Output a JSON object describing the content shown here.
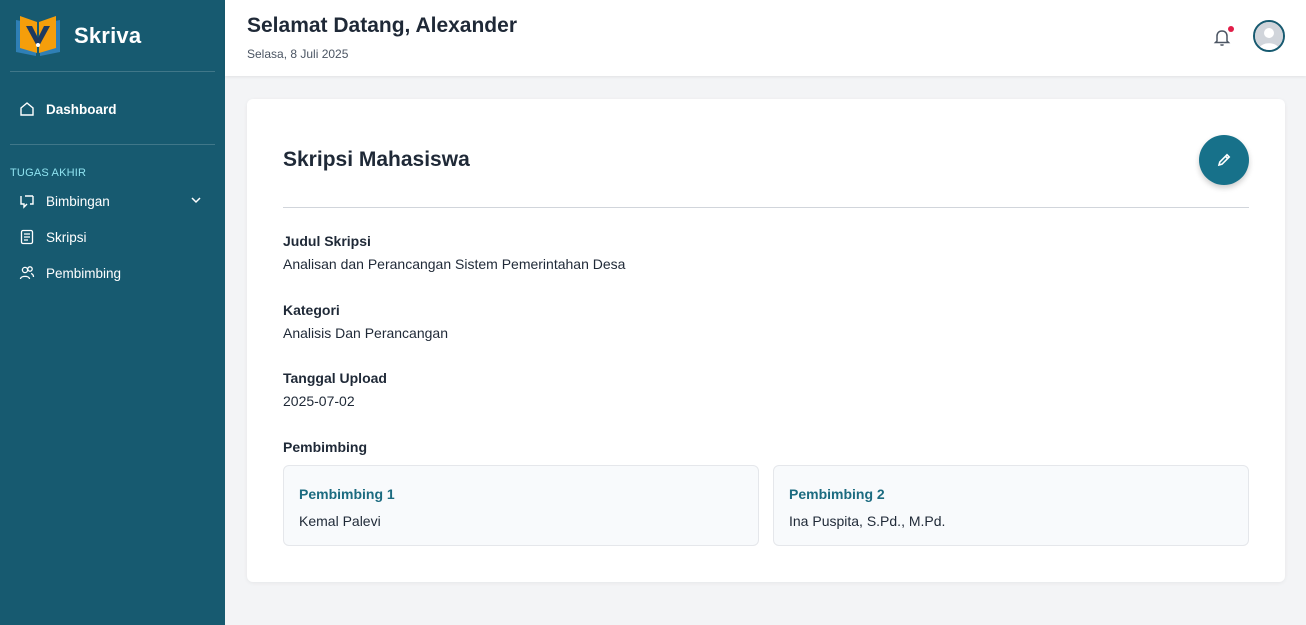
{
  "brand": {
    "name": "Skriva"
  },
  "sidebar": {
    "dashboard_label": "Dashboard",
    "section_label": "TUGAS AKHIR",
    "items": [
      {
        "label": "Bimbingan",
        "icon": "chat-icon"
      },
      {
        "label": "Skripsi",
        "icon": "document-icon"
      },
      {
        "label": "Pembimbing",
        "icon": "users-icon"
      }
    ]
  },
  "header": {
    "greeting": "Selamat Datang, Alexander",
    "date": "Selasa, 8 Juli 2025",
    "has_notification": true
  },
  "card": {
    "title": "Skripsi Mahasiswa",
    "fields": [
      {
        "label": "Judul Skripsi",
        "value": "Analisan dan Perancangan Sistem Pemerintahan Desa"
      },
      {
        "label": "Kategori",
        "value": "Analisis Dan Perancangan"
      },
      {
        "label": "Tanggal Upload",
        "value": "2025-07-02"
      }
    ],
    "pembimbing_label": "Pembimbing",
    "pembimbing": [
      {
        "title": "Pembimbing 1",
        "name": "Kemal Palevi"
      },
      {
        "title": "Pembimbing 2",
        "name": "Ina Puspita, S.Pd., M.Pd."
      }
    ]
  },
  "colors": {
    "sidebar_bg": "#175a70",
    "accent": "#17718a",
    "section_label": "#8fe3f0",
    "logo_orange": "#f59e0b",
    "notification_dot": "#e11d48"
  }
}
